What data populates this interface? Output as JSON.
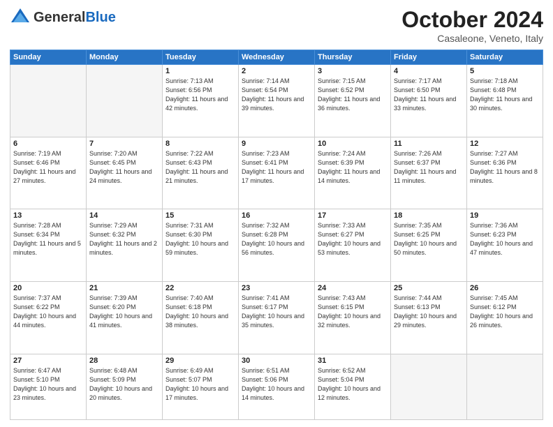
{
  "header": {
    "logo_general": "General",
    "logo_blue": "Blue",
    "month_title": "October 2024",
    "subtitle": "Casaleone, Veneto, Italy"
  },
  "weekdays": [
    "Sunday",
    "Monday",
    "Tuesday",
    "Wednesday",
    "Thursday",
    "Friday",
    "Saturday"
  ],
  "weeks": [
    [
      {
        "day": "",
        "sunrise": "",
        "sunset": "",
        "daylight": ""
      },
      {
        "day": "",
        "sunrise": "",
        "sunset": "",
        "daylight": ""
      },
      {
        "day": "1",
        "sunrise": "Sunrise: 7:13 AM",
        "sunset": "Sunset: 6:56 PM",
        "daylight": "Daylight: 11 hours and 42 minutes."
      },
      {
        "day": "2",
        "sunrise": "Sunrise: 7:14 AM",
        "sunset": "Sunset: 6:54 PM",
        "daylight": "Daylight: 11 hours and 39 minutes."
      },
      {
        "day": "3",
        "sunrise": "Sunrise: 7:15 AM",
        "sunset": "Sunset: 6:52 PM",
        "daylight": "Daylight: 11 hours and 36 minutes."
      },
      {
        "day": "4",
        "sunrise": "Sunrise: 7:17 AM",
        "sunset": "Sunset: 6:50 PM",
        "daylight": "Daylight: 11 hours and 33 minutes."
      },
      {
        "day": "5",
        "sunrise": "Sunrise: 7:18 AM",
        "sunset": "Sunset: 6:48 PM",
        "daylight": "Daylight: 11 hours and 30 minutes."
      }
    ],
    [
      {
        "day": "6",
        "sunrise": "Sunrise: 7:19 AM",
        "sunset": "Sunset: 6:46 PM",
        "daylight": "Daylight: 11 hours and 27 minutes."
      },
      {
        "day": "7",
        "sunrise": "Sunrise: 7:20 AM",
        "sunset": "Sunset: 6:45 PM",
        "daylight": "Daylight: 11 hours and 24 minutes."
      },
      {
        "day": "8",
        "sunrise": "Sunrise: 7:22 AM",
        "sunset": "Sunset: 6:43 PM",
        "daylight": "Daylight: 11 hours and 21 minutes."
      },
      {
        "day": "9",
        "sunrise": "Sunrise: 7:23 AM",
        "sunset": "Sunset: 6:41 PM",
        "daylight": "Daylight: 11 hours and 17 minutes."
      },
      {
        "day": "10",
        "sunrise": "Sunrise: 7:24 AM",
        "sunset": "Sunset: 6:39 PM",
        "daylight": "Daylight: 11 hours and 14 minutes."
      },
      {
        "day": "11",
        "sunrise": "Sunrise: 7:26 AM",
        "sunset": "Sunset: 6:37 PM",
        "daylight": "Daylight: 11 hours and 11 minutes."
      },
      {
        "day": "12",
        "sunrise": "Sunrise: 7:27 AM",
        "sunset": "Sunset: 6:36 PM",
        "daylight": "Daylight: 11 hours and 8 minutes."
      }
    ],
    [
      {
        "day": "13",
        "sunrise": "Sunrise: 7:28 AM",
        "sunset": "Sunset: 6:34 PM",
        "daylight": "Daylight: 11 hours and 5 minutes."
      },
      {
        "day": "14",
        "sunrise": "Sunrise: 7:29 AM",
        "sunset": "Sunset: 6:32 PM",
        "daylight": "Daylight: 11 hours and 2 minutes."
      },
      {
        "day": "15",
        "sunrise": "Sunrise: 7:31 AM",
        "sunset": "Sunset: 6:30 PM",
        "daylight": "Daylight: 10 hours and 59 minutes."
      },
      {
        "day": "16",
        "sunrise": "Sunrise: 7:32 AM",
        "sunset": "Sunset: 6:28 PM",
        "daylight": "Daylight: 10 hours and 56 minutes."
      },
      {
        "day": "17",
        "sunrise": "Sunrise: 7:33 AM",
        "sunset": "Sunset: 6:27 PM",
        "daylight": "Daylight: 10 hours and 53 minutes."
      },
      {
        "day": "18",
        "sunrise": "Sunrise: 7:35 AM",
        "sunset": "Sunset: 6:25 PM",
        "daylight": "Daylight: 10 hours and 50 minutes."
      },
      {
        "day": "19",
        "sunrise": "Sunrise: 7:36 AM",
        "sunset": "Sunset: 6:23 PM",
        "daylight": "Daylight: 10 hours and 47 minutes."
      }
    ],
    [
      {
        "day": "20",
        "sunrise": "Sunrise: 7:37 AM",
        "sunset": "Sunset: 6:22 PM",
        "daylight": "Daylight: 10 hours and 44 minutes."
      },
      {
        "day": "21",
        "sunrise": "Sunrise: 7:39 AM",
        "sunset": "Sunset: 6:20 PM",
        "daylight": "Daylight: 10 hours and 41 minutes."
      },
      {
        "day": "22",
        "sunrise": "Sunrise: 7:40 AM",
        "sunset": "Sunset: 6:18 PM",
        "daylight": "Daylight: 10 hours and 38 minutes."
      },
      {
        "day": "23",
        "sunrise": "Sunrise: 7:41 AM",
        "sunset": "Sunset: 6:17 PM",
        "daylight": "Daylight: 10 hours and 35 minutes."
      },
      {
        "day": "24",
        "sunrise": "Sunrise: 7:43 AM",
        "sunset": "Sunset: 6:15 PM",
        "daylight": "Daylight: 10 hours and 32 minutes."
      },
      {
        "day": "25",
        "sunrise": "Sunrise: 7:44 AM",
        "sunset": "Sunset: 6:13 PM",
        "daylight": "Daylight: 10 hours and 29 minutes."
      },
      {
        "day": "26",
        "sunrise": "Sunrise: 7:45 AM",
        "sunset": "Sunset: 6:12 PM",
        "daylight": "Daylight: 10 hours and 26 minutes."
      }
    ],
    [
      {
        "day": "27",
        "sunrise": "Sunrise: 6:47 AM",
        "sunset": "Sunset: 5:10 PM",
        "daylight": "Daylight: 10 hours and 23 minutes."
      },
      {
        "day": "28",
        "sunrise": "Sunrise: 6:48 AM",
        "sunset": "Sunset: 5:09 PM",
        "daylight": "Daylight: 10 hours and 20 minutes."
      },
      {
        "day": "29",
        "sunrise": "Sunrise: 6:49 AM",
        "sunset": "Sunset: 5:07 PM",
        "daylight": "Daylight: 10 hours and 17 minutes."
      },
      {
        "day": "30",
        "sunrise": "Sunrise: 6:51 AM",
        "sunset": "Sunset: 5:06 PM",
        "daylight": "Daylight: 10 hours and 14 minutes."
      },
      {
        "day": "31",
        "sunrise": "Sunrise: 6:52 AM",
        "sunset": "Sunset: 5:04 PM",
        "daylight": "Daylight: 10 hours and 12 minutes."
      },
      {
        "day": "",
        "sunrise": "",
        "sunset": "",
        "daylight": ""
      },
      {
        "day": "",
        "sunrise": "",
        "sunset": "",
        "daylight": ""
      }
    ]
  ]
}
